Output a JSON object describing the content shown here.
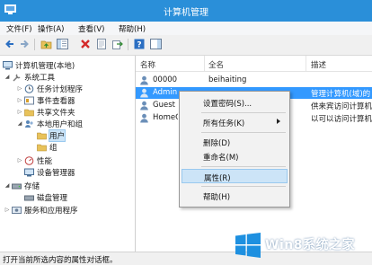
{
  "window": {
    "title": "计算机管理"
  },
  "menu": [
    "文件(F)",
    "操作(A)",
    "查看(V)",
    "帮助(H)"
  ],
  "toolbar": {
    "icons": [
      "back-arrow-icon",
      "forward-arrow-icon",
      "folder-up-icon",
      "console-tree-icon",
      "delete-icon",
      "properties-icon",
      "export-icon",
      "help-icon",
      "action-pane-icon"
    ]
  },
  "tree": {
    "root": "计算机管理(本地)",
    "system_tools": "系统工具",
    "task_scheduler": "任务计划程序",
    "event_viewer": "事件查看器",
    "shared_folders": "共享文件夹",
    "local_users": "本地用户和组",
    "users": "用户",
    "groups": "组",
    "performance": "性能",
    "device_manager": "设备管理器",
    "storage": "存储",
    "disk_management": "磁盘管理",
    "services_apps": "服务和应用程序"
  },
  "list": {
    "columns": [
      "名称",
      "全名",
      "描述"
    ],
    "rows": [
      {
        "name": "00000",
        "fullname": "beihaiting",
        "desc": ""
      },
      {
        "name": "Admin",
        "fullname": "",
        "desc": "管理计算机(域)的"
      },
      {
        "name": "Guest",
        "fullname": "",
        "desc": "供来宾访问计算机"
      },
      {
        "name": "HomeG",
        "fullname": "",
        "desc": "以可以访问计算机"
      }
    ]
  },
  "context_menu": {
    "set_password": "设置密码(S)...",
    "all_tasks": "所有任务(K)",
    "delete": "删除(D)",
    "rename": "重命名(M)",
    "properties": "属性(R)",
    "help": "帮助(H)"
  },
  "status": "打开当前所选内容的属性对话框。",
  "watermark": {
    "text": "Win8系统之家"
  },
  "colors": {
    "titlebar": "#2a8fd9",
    "selection": "#3399ff",
    "menu_highlight": "#cce4f7"
  }
}
